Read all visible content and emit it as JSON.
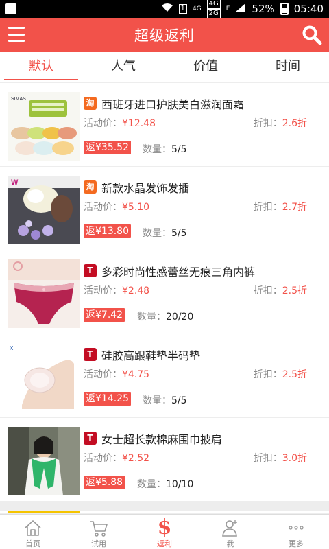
{
  "status": {
    "network_small_top": "4G",
    "network_box1": "4G",
    "network_box2": "2G",
    "e_mark": "E",
    "battery": "52%",
    "time": "05:40"
  },
  "header": {
    "title": "超级返利"
  },
  "tabs": [
    {
      "label": "默认",
      "active": true
    },
    {
      "label": "人气"
    },
    {
      "label": "价值"
    },
    {
      "label": "时间"
    }
  ],
  "labels": {
    "activity_price": "活动价：",
    "discount": "折扣：",
    "quantity": "数量："
  },
  "products": [
    {
      "source": "淘",
      "name": "西班牙进口护肤美白滋润面霜",
      "price": "¥12.48",
      "discount": "2.6折",
      "rebate": "返¥35.52",
      "quantity": "5/5"
    },
    {
      "source": "淘",
      "name": "新款水晶发饰发插",
      "price": "¥5.10",
      "discount": "2.7折",
      "rebate": "返¥13.80",
      "quantity": "5/5"
    },
    {
      "source": "T",
      "name": "多彩时尚性感蕾丝无痕三角内裤",
      "price": "¥2.48",
      "discount": "2.5折",
      "rebate": "返¥7.42",
      "quantity": "20/20"
    },
    {
      "source": "T",
      "name": "硅胶高跟鞋垫半码垫",
      "price": "¥4.75",
      "discount": "2.5折",
      "rebate": "返¥14.25",
      "quantity": "5/5"
    },
    {
      "source": "T",
      "name": "女士超长款棉麻围巾披肩",
      "price": "¥2.52",
      "discount": "3.0折",
      "rebate": "返¥5.88",
      "quantity": "10/10"
    }
  ],
  "nav": [
    {
      "label": "首页"
    },
    {
      "label": "试用"
    },
    {
      "label": "返利",
      "active": true
    },
    {
      "label": "我"
    },
    {
      "label": "更多"
    }
  ],
  "colors": {
    "accent": "#f2524a",
    "taobao": "#f46a20",
    "tmall": "#c30d23"
  }
}
